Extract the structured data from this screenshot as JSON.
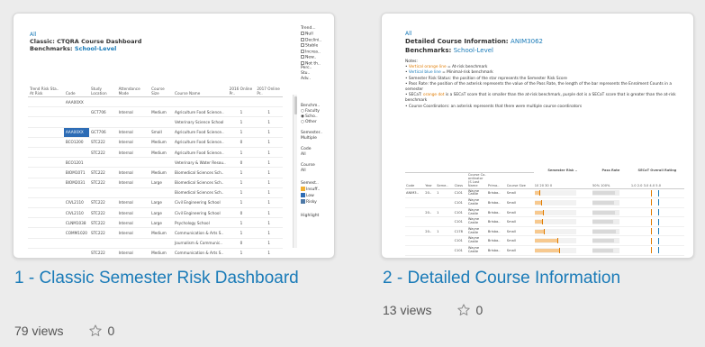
{
  "cards": [
    {
      "title": "1 - Classic Semester Risk Dashboard",
      "views": "79 views",
      "favorites": "0",
      "thumbnail": {
        "breadcrumb": "All",
        "title": "Classic: CTQRA Course Dashboard",
        "benchmarks_label": "Benchmarks:",
        "benchmarks_value": "School-Level",
        "table": {
          "headers": [
            "Trend Risk Sta.. At Risk",
            "Code",
            "Study Location",
            "Attendance Mode",
            "Course Size",
            "Course Name",
            "2016 Online Pr..",
            "2017 Online Pr.."
          ],
          "rows": [
            [
              "",
              "AAA00XX",
              "",
              "",
              "",
              "",
              "",
              ""
            ],
            [
              "",
              "",
              "GCT706",
              "Internal",
              "Medium",
              "Agriculture Food Science..",
              "1",
              "1"
            ],
            [
              "",
              "",
              "",
              "",
              "",
              "Veterinary Science School",
              "1",
              "1"
            ],
            [
              "",
              "AAA00XX",
              "GCT706",
              "Internal",
              "Small",
              "Agriculture Food Science..",
              "1",
              "1"
            ],
            [
              "",
              "BCO1200",
              "STC222",
              "Internal",
              "Medium",
              "Agriculture Food Science..",
              "0",
              "1"
            ],
            [
              "",
              "",
              "STC222",
              "Internal",
              "Medium",
              "Agriculture Food Science..",
              "1",
              "1"
            ],
            [
              "",
              "BCO1201",
              "",
              "",
              "",
              "Veterinary & Water Resou..",
              "0",
              "1"
            ],
            [
              "",
              "BIOM1071",
              "STC222",
              "Internal",
              "Medium",
              "Biomedical Sciences Sch..",
              "1",
              "1"
            ],
            [
              "",
              "BIOM2031",
              "STC222",
              "Internal",
              "Large",
              "Biomedical Sciences Sch..",
              "1",
              "1"
            ],
            [
              "",
              "",
              "",
              "",
              "",
              "Biomedical Sciences Sch..",
              "1",
              "1"
            ],
            [
              "",
              "CIVL2110",
              "STC222",
              "Internal",
              "Large",
              "Civil Engineering School",
              "1",
              "1"
            ],
            [
              "",
              "CIVL2110",
              "STC222",
              "Internal",
              "Large",
              "Civil Engineering School",
              "0",
              "1"
            ],
            [
              "",
              "CLNM1038",
              "STC222",
              "Internal",
              "Large",
              "Psychology School",
              "1",
              "1"
            ],
            [
              "",
              "COMM1020",
              "STC222",
              "Internal",
              "Medium",
              "Communication & Arts S..",
              "1",
              "1"
            ],
            [
              "",
              "",
              "",
              "",
              "",
              "Journalism & Communic..",
              "0",
              "1"
            ],
            [
              "",
              "",
              "STC222",
              "Internal",
              "Medium",
              "Communication & Arts S..",
              "1",
              "1"
            ]
          ]
        },
        "side": {
          "trend_label": "Trend...",
          "trend_options": [
            "Null",
            "Declini..",
            "Stable",
            "Increa..",
            "New..",
            "Not th.."
          ],
          "trend_extra": [
            "Perc..",
            "Stu..",
            "Adv.."
          ],
          "benchmark_label": "Benchm..",
          "benchmark_options": [
            "Faculty",
            "Scho..",
            "Other"
          ],
          "semester_label": "Semester..",
          "semester_value": "Multiple",
          "code_label": "Code",
          "code_value": "All",
          "course_label": "Course",
          "course_value": "All",
          "semester_risk_label": "Semest..",
          "risk_legend": [
            "Insuff..",
            "Low",
            "Risky"
          ],
          "highlight_label": "Highlight"
        }
      }
    },
    {
      "title": "2 - Detailed Course Information",
      "views": "13 views",
      "favorites": "0",
      "thumbnail": {
        "breadcrumb": "All",
        "title_prefix": "Detailed Course Information:",
        "title_value": "ANIM3062",
        "benchmarks_label": "Benchmarks:",
        "benchmarks_value": "School-Level",
        "notes_title": "Notes:",
        "notes": [
          {
            "pre": "",
            "hl": "Vertical orange line",
            "cls": "o",
            "post": " = At-risk benchmark"
          },
          {
            "pre": "",
            "hl": "Vertical blue line",
            "cls": "b",
            "post": " = Minimal-risk benchmark"
          },
          {
            "pre": "Semester Risk Status: the position of the star represents the Semester Risk Score",
            "hl": "",
            "cls": "",
            "post": ""
          },
          {
            "pre": "Pass Rate: the position of the asterisk represents the value of the Pass Rate, the length of the bar represents the Enrolment Counts in a semester",
            "hl": "",
            "cls": "",
            "post": ""
          },
          {
            "pre": "SECaT: ",
            "hl": "orange dot",
            "cls": "o",
            "post": " is a SECaT score that is smaller than the at-risk benchmark, purple dot is a SECaT score that is greater than the at-risk benchmark"
          },
          {
            "pre": "Course Coordinators: an asterisk represents that there were multiple course coordinators",
            "hl": "",
            "cls": "",
            "post": ""
          }
        ],
        "table": {
          "group_headers": [
            "Semester Risk ..",
            "Pass Rate",
            "SECaT Overall Rating"
          ],
          "headers": [
            "Code",
            "Year",
            "Seme..",
            "Class",
            "Course Co-ordinator (S Last Name",
            "Prima..",
            "Course Size"
          ],
          "risk_ticks": [
            "10",
            "20",
            "30",
            "0"
          ],
          "pass_ticks": [
            "50%",
            "100%"
          ],
          "secat_ticks": [
            "1.0",
            "2.0",
            "3.0",
            "4.0",
            "5.0"
          ],
          "rows": [
            {
              "code": "ANIM3..",
              "year": "20..",
              "sem": "1",
              "cls": "C101",
              "coord": "Wayne Castle",
              "prim": "Brisba..",
              "size": "Small",
              "risk": 0.12,
              "pass": 0.82
            },
            {
              "code": "",
              "year": "",
              "sem": "",
              "cls": "C101",
              "coord": "Wayne Castle",
              "prim": "Brisba..",
              "size": "Small",
              "risk": 0.15,
              "pass": 0.8
            },
            {
              "code": "",
              "year": "20..",
              "sem": "1",
              "cls": "C101",
              "coord": "Wayne Castle",
              "prim": "Brisba..",
              "size": "Small",
              "risk": 0.2,
              "pass": 0.84
            },
            {
              "code": "",
              "year": "",
              "sem": "",
              "cls": "C101",
              "coord": "Wayne Castle",
              "prim": "Brisba..",
              "size": "Small",
              "risk": 0.18,
              "pass": 0.78
            },
            {
              "code": "",
              "year": "20..",
              "sem": "1",
              "cls": "C178",
              "coord": "Wayne Castle",
              "prim": "Brisba..",
              "size": "Small",
              "risk": 0.22,
              "pass": 0.86
            },
            {
              "code": "",
              "year": "",
              "sem": "",
              "cls": "C101",
              "coord": "Wayne Castle",
              "prim": "Brisba..",
              "size": "Small",
              "risk": 0.55,
              "pass": 0.8
            },
            {
              "code": "",
              "year": "",
              "sem": "",
              "cls": "C101",
              "coord": "Wayne Castle",
              "prim": "Brisba..",
              "size": "Small",
              "risk": 0.6,
              "pass": 0.75
            }
          ]
        }
      }
    }
  ]
}
